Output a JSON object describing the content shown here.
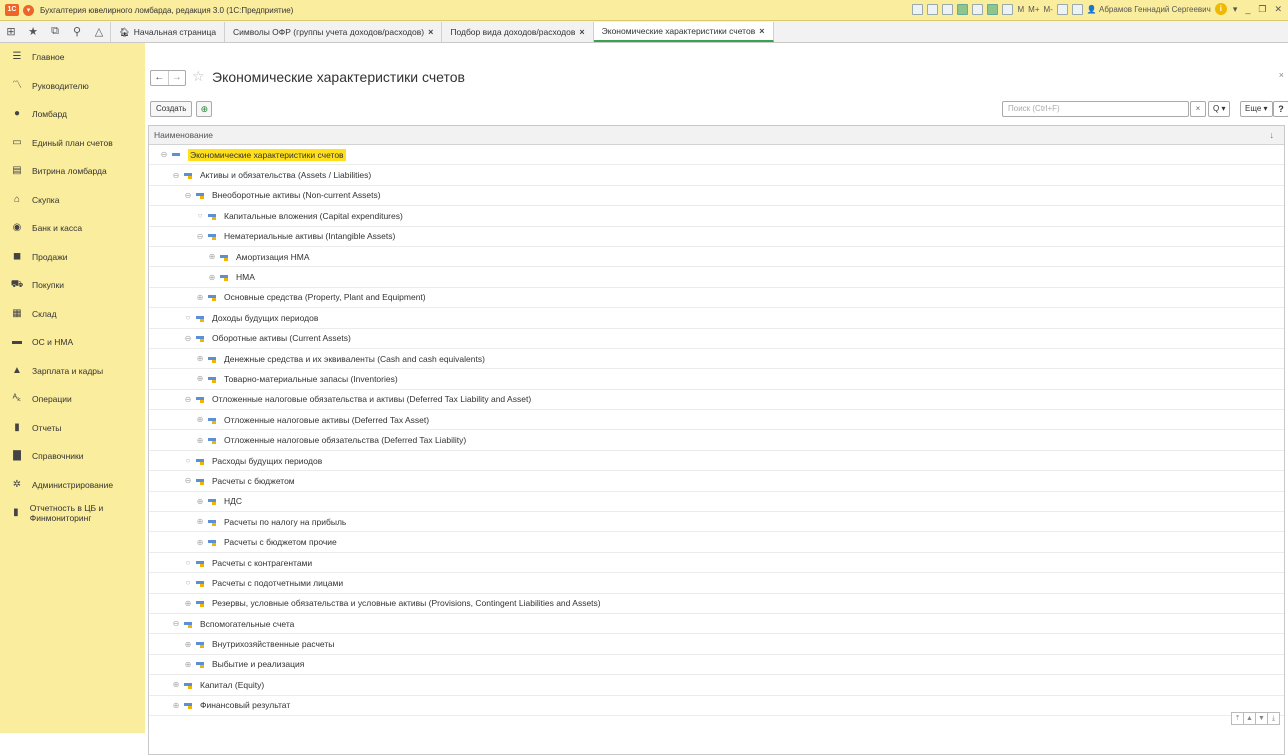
{
  "titlebar": {
    "title": "Бухгалтерия ювелирного ломбарда, редакция 3.0 (1С:Предприятие)",
    "logo": "1С",
    "toolbar_text_m": "M",
    "toolbar_text_mplus": "M+",
    "toolbar_text_mminus": "M-",
    "user": "Абрамов Геннадий Сергеевич",
    "info": "i"
  },
  "tabs": [
    {
      "label": "Начальная страница",
      "closable": false
    },
    {
      "label": "Символы ОФР (группы учета доходов/расходов)",
      "closable": true
    },
    {
      "label": "Подбор вида доходов/расходов",
      "closable": true
    },
    {
      "label": "Экономические характеристики счетов",
      "closable": true,
      "active": true
    }
  ],
  "tab_close": "×",
  "sidebar": {
    "items": [
      {
        "label": "Главное",
        "icon": "menu-icon"
      },
      {
        "label": "Руководителю",
        "icon": "chart-line-icon"
      },
      {
        "label": "Ломбард",
        "icon": "money-bag-icon"
      },
      {
        "label": "Единый план счетов",
        "icon": "book-icon"
      },
      {
        "label": "Витрина ломбарда",
        "icon": "showcase-icon"
      },
      {
        "label": "Скупка",
        "icon": "bank-icon"
      },
      {
        "label": "Банк и касса",
        "icon": "coin-icon"
      },
      {
        "label": "Продажи",
        "icon": "shopping-bag-icon"
      },
      {
        "label": "Покупки",
        "icon": "cart-icon"
      },
      {
        "label": "Склад",
        "icon": "warehouse-icon"
      },
      {
        "label": "ОС и НМА",
        "icon": "truck-icon"
      },
      {
        "label": "Зарплата и кадры",
        "icon": "person-icon"
      },
      {
        "label": "Операции",
        "icon": "operations-icon"
      },
      {
        "label": "Отчеты",
        "icon": "bar-chart-icon"
      },
      {
        "label": "Справочники",
        "icon": "reference-book-icon"
      },
      {
        "label": "Администрирование",
        "icon": "gear-icon"
      },
      {
        "label": "Отчетность в ЦБ и Финмониторинг",
        "icon": "bar-chart-icon"
      }
    ]
  },
  "page": {
    "title": "Экономические характеристики счетов",
    "back": "←",
    "forward": "→",
    "close": "×"
  },
  "toolbar": {
    "create_label": "Создать",
    "search_placeholder": "Поиск (Ctrl+F)",
    "search_clear": "×",
    "search_button": "Q ▾",
    "more_label": "Еще ▾",
    "help_label": "?"
  },
  "grid": {
    "column_header": "Наименование",
    "sort_indicator": "↓",
    "rows": [
      {
        "label": "Экономические характеристики счетов",
        "level": 0,
        "state": "expanded",
        "root": true
      },
      {
        "label": "Активы и обязательства (Assets / Liabilities)",
        "level": 1,
        "state": "expanded"
      },
      {
        "label": "Внеоборотные активы (Non-current Assets)",
        "level": 2,
        "state": "expanded"
      },
      {
        "label": "Капитальные вложения (Capital expenditures)",
        "level": 3,
        "state": "leaf"
      },
      {
        "label": "Нематериальные активы (Intangible Assets)",
        "level": 3,
        "state": "expanded"
      },
      {
        "label": "Амортизация НМА",
        "level": 4,
        "state": "collapsed"
      },
      {
        "label": "НМА",
        "level": 4,
        "state": "collapsed"
      },
      {
        "label": "Основные средства (Property, Plant and Equipment)",
        "level": 3,
        "state": "collapsed"
      },
      {
        "label": "Доходы будущих периодов",
        "level": 2,
        "state": "leaf"
      },
      {
        "label": "Оборотные активы (Current Assets)",
        "level": 2,
        "state": "expanded"
      },
      {
        "label": "Денежные средства и их эквиваленты (Cash and cash equivalents)",
        "level": 3,
        "state": "collapsed"
      },
      {
        "label": "Товарно-материальные запасы (Inventories)",
        "level": 3,
        "state": "collapsed"
      },
      {
        "label": "Отложенные налоговые обязательства и активы (Deferred Tax Liability and Asset)",
        "level": 2,
        "state": "expanded"
      },
      {
        "label": "Отложенные налоговые активы (Deferred Tax Asset)",
        "level": 3,
        "state": "collapsed"
      },
      {
        "label": "Отложенные налоговые обязательства (Deferred Tax Liability)",
        "level": 3,
        "state": "collapsed"
      },
      {
        "label": "Расходы будущих периодов",
        "level": 2,
        "state": "leaf"
      },
      {
        "label": "Расчеты с бюджетом",
        "level": 2,
        "state": "expanded"
      },
      {
        "label": "НДС",
        "level": 3,
        "state": "collapsed"
      },
      {
        "label": "Расчеты по налогу на прибыль",
        "level": 3,
        "state": "collapsed"
      },
      {
        "label": "Расчеты с бюджетом прочие",
        "level": 3,
        "state": "collapsed"
      },
      {
        "label": "Расчеты с контрагентами",
        "level": 2,
        "state": "leaf"
      },
      {
        "label": "Расчеты с подотчетными лицами",
        "level": 2,
        "state": "leaf"
      },
      {
        "label": "Резервы, условные обязательства и условные активы (Provisions, Contingent Liabilities and Assets)",
        "level": 2,
        "state": "collapsed"
      },
      {
        "label": "Вспомогательные счета",
        "level": 1,
        "state": "expanded"
      },
      {
        "label": "Внутрихозяйственные расчеты",
        "level": 2,
        "state": "collapsed"
      },
      {
        "label": "Выбытие и реализация",
        "level": 2,
        "state": "collapsed"
      },
      {
        "label": "Капитал (Equity)",
        "level": 1,
        "state": "collapsed"
      },
      {
        "label": "Финансовый результат",
        "level": 1,
        "state": "collapsed"
      }
    ]
  },
  "pager": [
    "⤒",
    "▲",
    "▼",
    "⤓"
  ],
  "colors": {
    "sidebar_bg": "#fbed9e",
    "highlight": "#ffe01a",
    "active_tab": "#3aa14e"
  }
}
